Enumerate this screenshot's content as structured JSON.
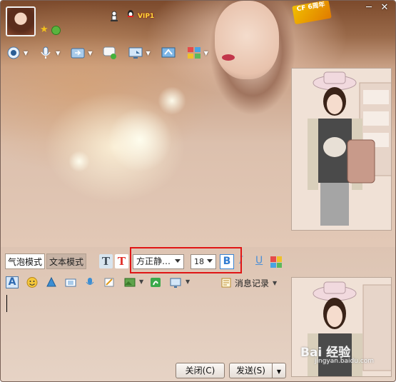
{
  "titlebar": {
    "vip_label": "VIP1",
    "badge_text": "CF 6周年",
    "icons": [
      "avatar",
      "star-icon",
      "qzone-icon",
      "chess-icon",
      "penguin-icon",
      "minimize-icon",
      "close-icon"
    ]
  },
  "main_toolbar": {
    "icons": [
      "video-call-icon",
      "voice-call-icon",
      "file-transfer-icon",
      "message-icon",
      "remote-desktop-icon",
      "share-screen-icon",
      "apps-icon"
    ]
  },
  "format_bar": {
    "mode_bubble": "气泡模式",
    "mode_text": "文本模式",
    "font_name": "方正静…",
    "font_size": "18",
    "bold_label": "B",
    "italic_label": "I",
    "underline_label": "U",
    "text_style_label": "T",
    "text_color_label": "T",
    "highlight_color": "#e01515"
  },
  "emoji_bar": {
    "font_label": "A",
    "msg_log_label": "消息记录",
    "icons": [
      "font-icon",
      "smiley-icon",
      "magic-icon",
      "screenshot-icon",
      "voice-msg-icon",
      "notes-icon",
      "image-icon",
      "doodle-icon",
      "screen-capture-icon"
    ]
  },
  "buttons": {
    "close": "关闭(C)",
    "send": "发送(S)"
  },
  "watermark": {
    "main": "Bai 经验",
    "sub": "jingyan.baidu.com"
  }
}
